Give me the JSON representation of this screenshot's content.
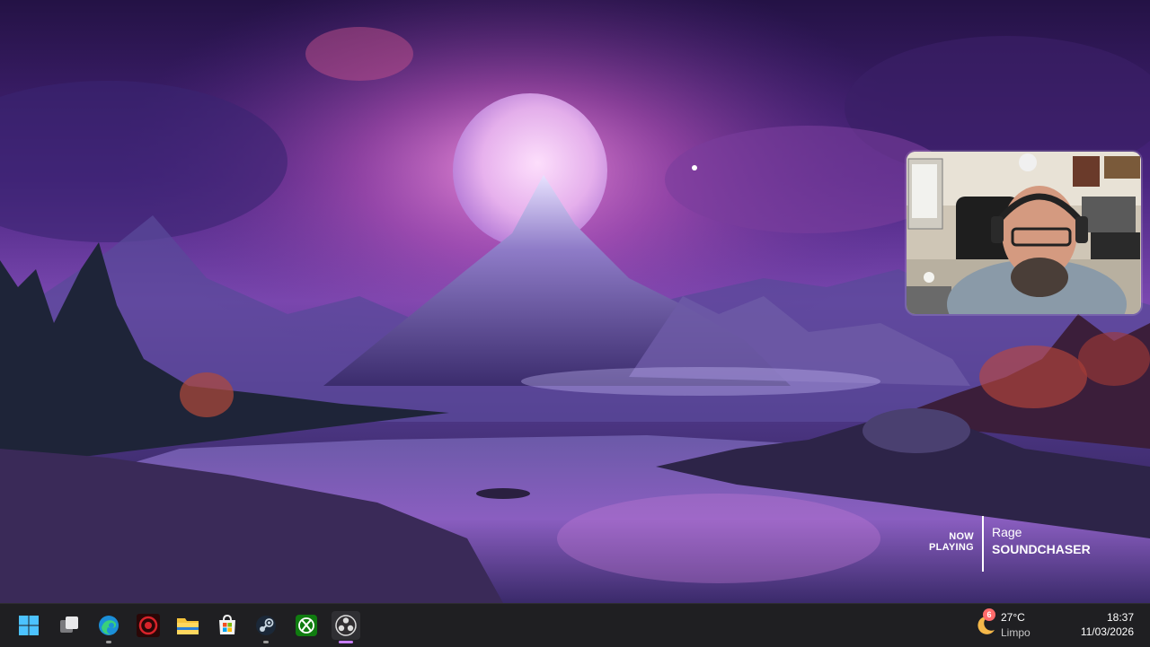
{
  "now_playing": {
    "label_line1": "NOW",
    "label_line2": "PLAYING",
    "artist": "Rage",
    "title": "SOUNDCHASER"
  },
  "taskbar": {
    "icons": [
      {
        "name": "start-icon"
      },
      {
        "name": "task-view-icon"
      },
      {
        "name": "edge-icon"
      },
      {
        "name": "app-red-icon"
      },
      {
        "name": "file-explorer-icon"
      },
      {
        "name": "microsoft-store-icon"
      },
      {
        "name": "steam-icon"
      },
      {
        "name": "xbox-icon"
      },
      {
        "name": "obs-icon",
        "active": true
      }
    ]
  },
  "weather": {
    "badge": "6",
    "temperature": "27°C",
    "condition": "Limpo"
  },
  "clock": {
    "time": "18:37",
    "date": "11/03/2026"
  },
  "colors": {
    "accent": "#c77dff",
    "taskbar_bg": "#1f1f22"
  }
}
